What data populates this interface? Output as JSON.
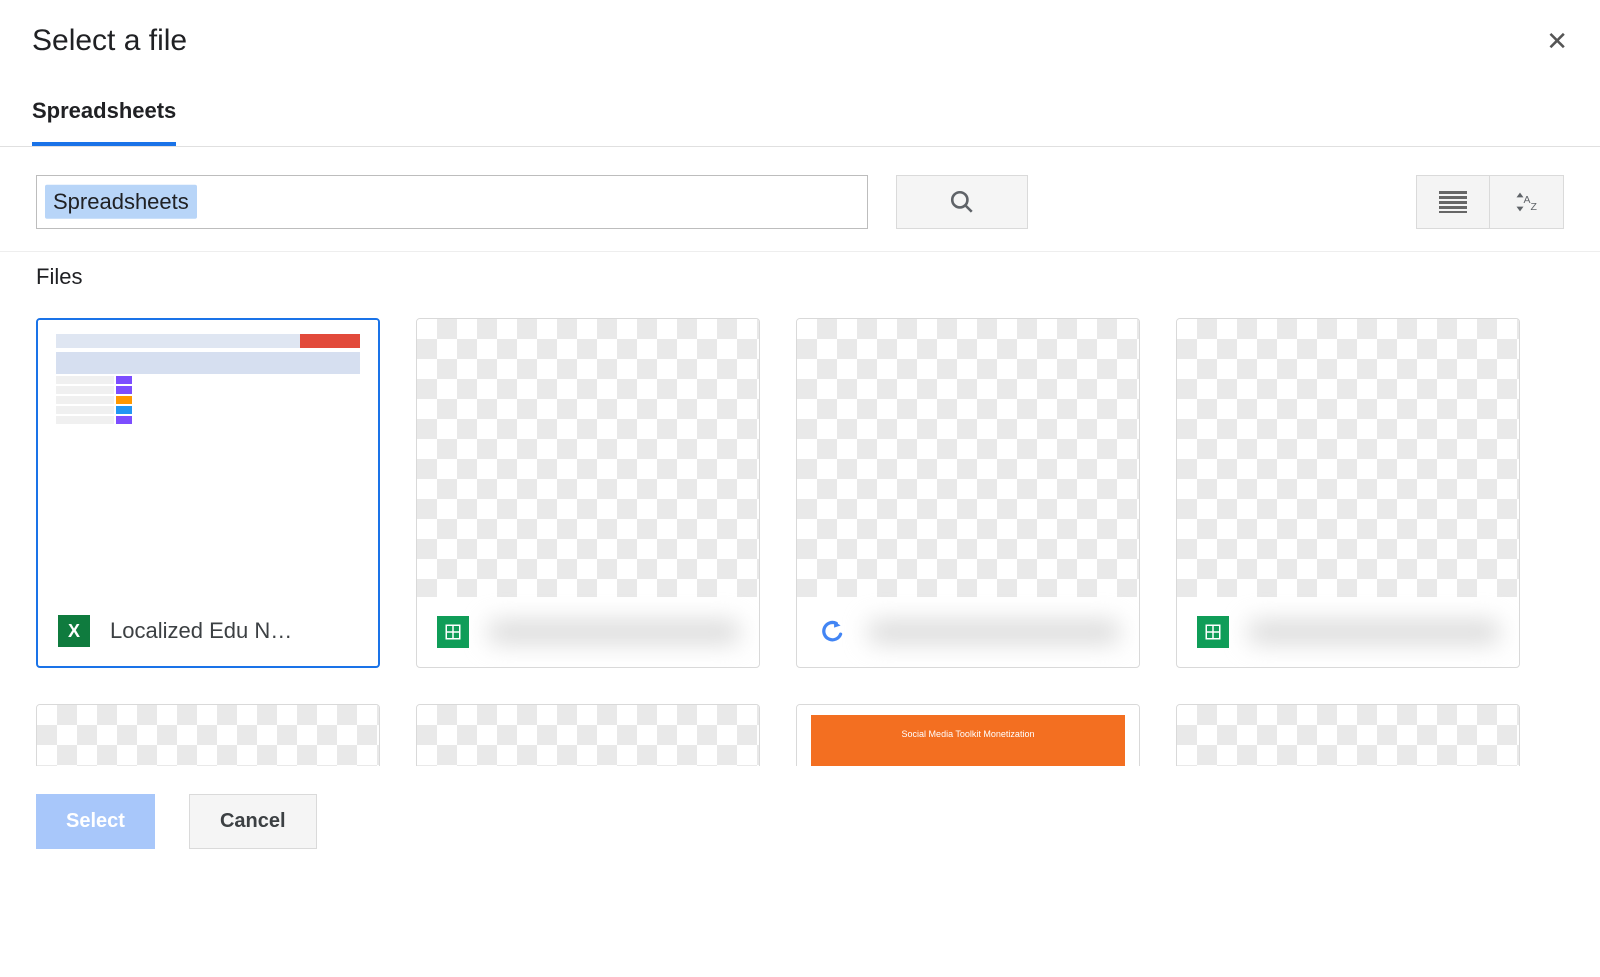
{
  "dialog": {
    "title": "Select a file",
    "close_glyph": "✕"
  },
  "tabs": {
    "active": "Spreadsheets"
  },
  "search": {
    "chip": "Spreadsheets",
    "value": ""
  },
  "sections": {
    "files_label": "Files"
  },
  "files": [
    {
      "name": "Localized Edu N…",
      "icon": "excel",
      "selected": true,
      "thumb": "sheet"
    },
    {
      "name": "",
      "icon": "sheets",
      "selected": false,
      "thumb": "transparent",
      "name_redacted": true
    },
    {
      "name": "",
      "icon": "script",
      "selected": false,
      "thumb": "transparent",
      "name_redacted": true
    },
    {
      "name": "",
      "icon": "sheets",
      "selected": false,
      "thumb": "transparent",
      "name_redacted": true
    }
  ],
  "files_row2": [
    {
      "thumb": "transparent"
    },
    {
      "thumb": "transparent"
    },
    {
      "thumb": "orange",
      "title_line1": "Social Media Toolkit Monetization"
    },
    {
      "thumb": "transparent"
    }
  ],
  "footer": {
    "select": "Select",
    "cancel": "Cancel"
  },
  "icons": {
    "sheets_glyph": "▦",
    "excel_glyph": "X"
  }
}
